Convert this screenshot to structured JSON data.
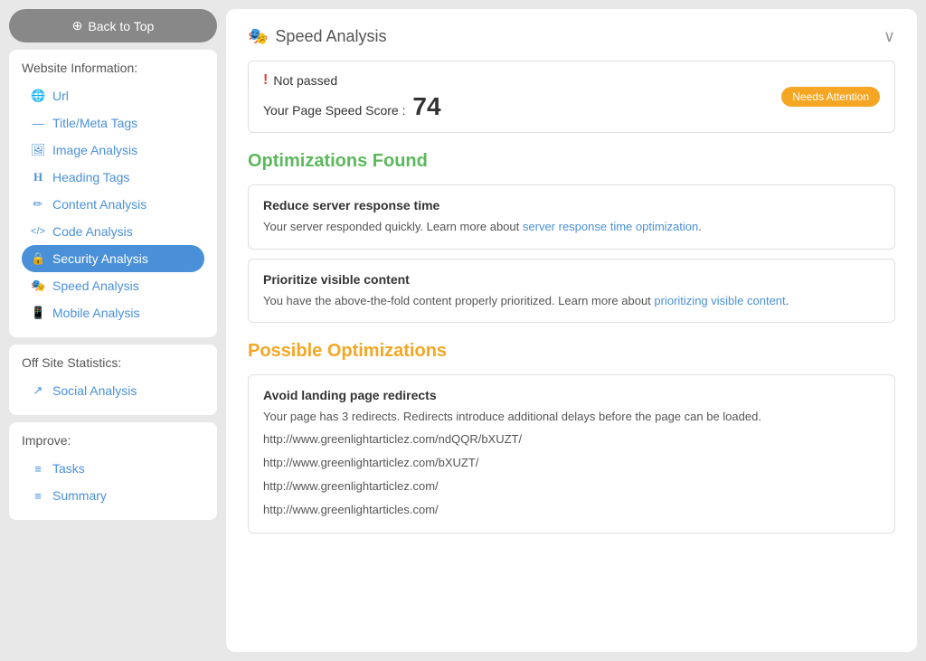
{
  "sidebar": {
    "back_to_top": "Back to Top",
    "website_info_title": "Website Information:",
    "website_items": [
      {
        "label": "Url",
        "icon": "🌐"
      },
      {
        "label": "Title/Meta Tags",
        "icon": "—"
      },
      {
        "label": "Image Analysis",
        "icon": "🖼"
      },
      {
        "label": "Heading Tags",
        "icon": "H"
      },
      {
        "label": "Content Analysis",
        "icon": "✏"
      },
      {
        "label": "Code Analysis",
        "icon": "</>"
      },
      {
        "label": "Security Analysis",
        "icon": "🔒",
        "active": true
      },
      {
        "label": "Speed Analysis",
        "icon": "🎭"
      },
      {
        "label": "Mobile Analysis",
        "icon": "📱"
      }
    ],
    "offsite_title": "Off Site Statistics:",
    "offsite_items": [
      {
        "label": "Social Analysis",
        "icon": "↗"
      }
    ],
    "improve_title": "Improve:",
    "improve_items": [
      {
        "label": "Tasks",
        "icon": "≡"
      },
      {
        "label": "Summary",
        "icon": "≡"
      }
    ]
  },
  "main": {
    "section_icon": "🎭",
    "section_title": "Speed Analysis",
    "status": {
      "not_passed": "Not passed",
      "score_label": "Your Page Speed Score :",
      "score_value": "74",
      "badge": "Needs Attention"
    },
    "optimizations_found_title": "Optimizations Found",
    "optimizations_found": [
      {
        "title": "Reduce server response time",
        "description": "Your server responded quickly. Learn more about",
        "link_text": "server response time optimization",
        "description_suffix": "."
      },
      {
        "title": "Prioritize visible content",
        "description": "You have the above-the-fold content properly prioritized. Learn more about",
        "link_text": "prioritizing visible content",
        "description_suffix": "."
      }
    ],
    "possible_optimizations_title": "Possible Optimizations",
    "possible_optimizations": [
      {
        "title": "Avoid landing page redirects",
        "description": "Your page has 3 redirects. Redirects introduce additional delays before the page can be loaded.",
        "urls": [
          "http://www.greenlightarticlez.com/ndQQR/bXUZT/",
          "http://www.greenlightarticlez.com/bXUZT/",
          "http://www.greenlightarticlez.com/",
          "http://www.greenlightarticles.com/"
        ]
      }
    ]
  }
}
